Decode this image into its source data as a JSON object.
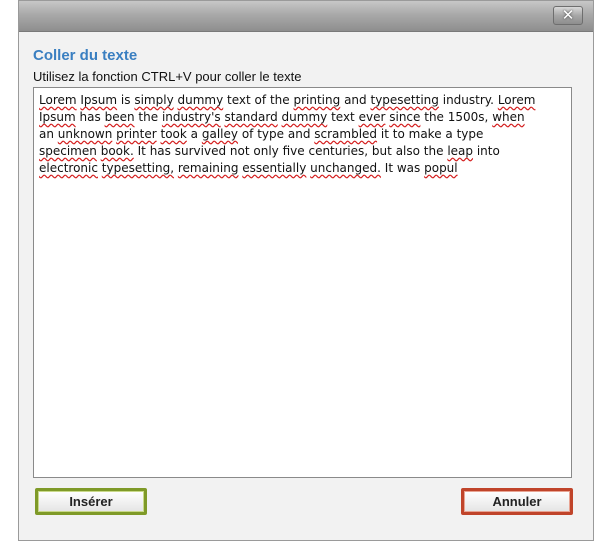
{
  "dialog": {
    "close_label": "✕",
    "heading": "Coller du texte",
    "instructions": "Utilisez la fonction CTRL+V pour coller le texte",
    "text_lines": [
      "Lorem Ipsum is simply dummy text of the printing and typesetting industry. Lorem",
      "Ipsum has been the industry's standard dummy text ever since the 1500s, when",
      "an unknown printer took a galley of type and scrambled it to make a type",
      "specimen book. It has survived not only five centuries, but also the leap into",
      "electronic typesetting, remaining essentially unchanged. It was popul"
    ],
    "insert_label": "Insérer",
    "cancel_label": "Annuler"
  },
  "colors": {
    "heading": "#3a7fc1",
    "insert_border": "#7f9a28",
    "cancel_border": "#c0442a",
    "spellcheck_underline": "#d42020"
  },
  "icons": [
    "close-icon"
  ]
}
